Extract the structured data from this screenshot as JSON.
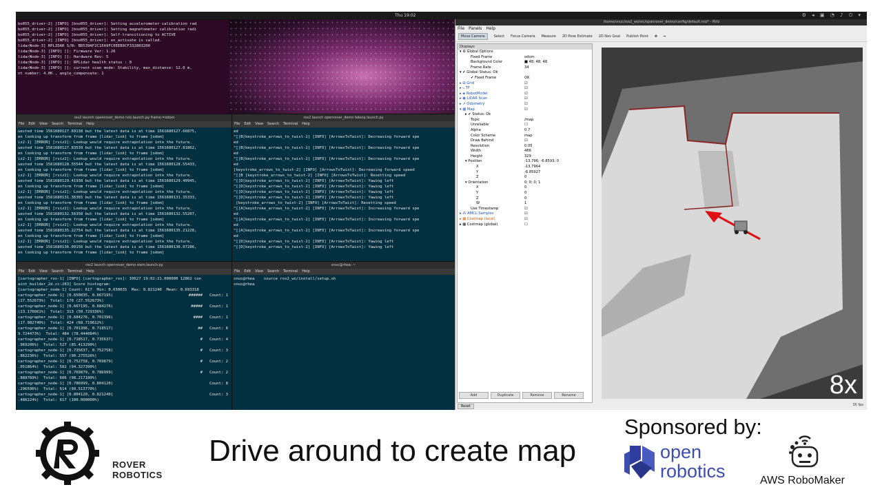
{
  "topbar": {
    "clock": "Thu 19:02",
    "tray": "⚙ ◂ ▣ ◔ ♪ ⏻ ▾"
  },
  "terminals": {
    "drive": {
      "lines": [
        "bo055_driver-2] [INFO] [bno055_driver]: Setting accelerometer calibration rad",
        "",
        "bo055_driver-2] [INFO] [bno055_driver]: Setting magnetometer calibration radi",
        "",
        "bo055_driver-2] [INFO] [bno055_driver]: Self-transitioning to ACTIVE",
        "bo055_driver-2] [INFO] [bno055_driver]: on_activate is called.",
        "lidarNode-3] RPLIDAR S/N: BD539AF2C1EA9FC0EEB9CF332803200",
        "lidarNode-3] [INFO] []: Firmware Ver: 1.26",
        "lidarNode-3] [INFO] []: Hardware Rev: 5",
        "lidarNode-3] [INFO] []: RPLidar health status : 0",
        "lidarNode-3] [INFO] []: current scan mode: Stability, max_distance: 12.0 m,",
        "nt number: 4.0K , angle_compensate: 1"
      ]
    },
    "rviz": {
      "title": "ros2 launch openrover_demo rviz.launch.py frame:=odom",
      "menu": [
        "File",
        "Edit",
        "View",
        "Search",
        "Terminal",
        "Help"
      ],
      "lines": [
        "uested time 1561680127.69138 but the latest data is at time 1561680127.66875,",
        "en looking up transform from frame [lidar_link] to frame [odom]",
        "iz2-1] [ERROR] [rviz2]: Lookup would require extrapolation into the future.",
        "uested time 1561680127.83539 but the latest data is at time 1561680127.81862,",
        "en looking up transform from frame [lidar_link] to frame [odom]",
        "iz2-1] [ERROR] [rviz2]: Lookup would require extrapolation into the future.",
        "uested time 1561680128.55544 but the latest data is at time 1561680128.55433,",
        "en looking up transform from frame [lidar_link] to frame [odom]",
        "iz2-1] [ERROR] [rviz2]: Lookup would require extrapolation into the future.",
        "uested time 1561680129.41938 but the latest data is at time 1561680129.40945,",
        "en looking up transform from frame [lidar_link] to frame [odom]",
        "iz2-1] [ERROR] [rviz2]: Lookup would require extrapolation into the future.",
        "uested time 1561680131.36365 but the latest data is at time 1561680131.35333,",
        "en looking up transform from frame [lidar_link] to frame [odom]",
        "iz2-1] [ERROR] [rviz2]: Lookup would require extrapolation into the future.",
        "uested time 1561680132.56358 but the latest data is at time 1561680132.55207,",
        "en looking up transform from frame [lidar_link] to frame [odom]",
        "iz2-1] [ERROR] [rviz2]: Lookup would require extrapolation into the future.",
        "uested time 1561680135.22754 but the latest data is at time 1561680135.21228,",
        "en looking up transform from frame [lidar_link] to frame [odom]",
        "iz2-1] [ERROR] [rviz2]: Lookup would require extrapolation into the future.",
        "uested time 1561680136.09156 but the latest data is at time 1561680136.07286,",
        "en looking up transform from frame [lidar_link] to frame [odom]"
      ]
    },
    "teleop": {
      "title": "ros2 launch openrover_demo teleop.launch.py",
      "menu": [
        "File",
        "Edit",
        "View",
        "Search",
        "Terminal",
        "Help"
      ],
      "lines": [
        "ed",
        "^[[B[keystroke_arrows_to_twist-2] [INFO] [ArrowsToTwist]: Decreasing forward spe",
        "ed",
        "^[[B[keystroke_arrows_to_twist-2] [INFO] [ArrowsToTwist]: Decreasing forward spe",
        "ed",
        "^[[B[keystroke_arrows_to_twist-2] [INFO] [ArrowsToTwist]: Decreasing forward spe",
        "ed",
        "[keystroke_arrows_to_twist-2] [INFO] [ArrowsToTwist]: Decreasing forward speed",
        "^[[B [keystroke_arrows_to_twist-2] [INFO] [ArrowsToTwist]: Resetting speed",
        "^[[D[keystroke_arrows_to_twist-2] [INFO] [ArrowsToTwist]: Yawing left",
        "^[[D[keystroke_arrows_to_twist-2] [INFO] [ArrowsToTwist]: Yawing left",
        "^[[D[keystroke_arrows_to_twist-2] [INFO] [ArrowsToTwist]: Yawing left",
        "^[[D[keystroke_arrows_to_twist-2] [INFO] [ArrowsToTwist]: Yawing left",
        " [keystroke_arrows_to_twist-2] [INFO] [ArrowsToTwist]: Resetting speed",
        "^[[A[keystroke_arrows_to_twist-2] [INFO] [ArrowsToTwist]: Increasing forward spe",
        "ed",
        "^[[A[keystroke_arrows_to_twist-2] [INFO] [ArrowsToTwist]: Increasing forward spe",
        "ed",
        "^[[A[keystroke_arrows_to_twist-2] [INFO] [ArrowsToTwist]: Increasing forward spe",
        "ed",
        "^[[D[keystroke_arrows_to_twist-2] [INFO] [ArrowsToTwist]: Yawing left",
        "^[[D[keystroke_arrows_to_twist-2] [INFO] [ArrowsToTwist]: Yawing left"
      ]
    },
    "slam": {
      "title": "ros2 launch openrover_demo slam.launch.py",
      "menu": [
        "File",
        "Edit",
        "View",
        "Search",
        "Terminal",
        "Help"
      ],
      "lines": [
        {
          "l": "[cartographer_ros-1] [INFO] [cartographer_ros]: I0627 19:02:21.000000 12862 con",
          "r": ""
        },
        {
          "l": "aint_builder_2d.cc:283] Score histogram:",
          "r": ""
        },
        {
          "l": "[cartographer_node-1] Count: 617  Min: 0.650035  Max: 0.821240  Mean: 0.693318",
          "r": ""
        },
        {
          "l": "cartographer_node-1] [0.650035, 0.667195)",
          "r": "######   Count: 1"
        },
        {
          "l": "(27.552673%)  Total: 170 (27.552673%)",
          "r": ""
        },
        {
          "l": "cartographer_node-1] [0.667195, 0.684276)",
          "r": "#####   Count: 1"
        },
        {
          "l": "(23.176661%)  Total: 313 (50.729336%)",
          "r": ""
        },
        {
          "l": "cartographer_node-1] [0.684276, 0.701396)",
          "r": "####   Count: 1"
        },
        {
          "l": "(17.982740%)  Total: 424 (68.719612%)",
          "r": ""
        },
        {
          "l": "cartographer_node-1] [0.701396, 0.718517)",
          "r": "##   Count: 6"
        },
        {
          "l": "9.724473%)  Total: 484 (78.444084%)",
          "r": ""
        },
        {
          "l": "cartographer_node-1] [0.718517, 0.735637)",
          "r": "#   Count: 4"
        },
        {
          "l": ".969206%)  Total: 527 (85.413290%)",
          "r": ""
        },
        {
          "l": "cartographer_node-1] [0.735637, 0.752758)",
          "r": "#   Count: 3"
        },
        {
          "l": ".862236%)  Total: 557 (90.275526%)",
          "r": ""
        },
        {
          "l": "cartographer_node-1] [0.752758, 0.769879)",
          "r": "#   Count: 2"
        },
        {
          "l": ".051864%)  Total: 582 (94.327390%)",
          "r": ""
        },
        {
          "l": "cartographer_node-1] [0.769879, 0.786999)",
          "r": "#   Count: 2"
        },
        {
          "l": ".889789%)  Total: 606 (98.217180%)",
          "r": ""
        },
        {
          "l": "cartographer_node-1] [0.786999, 0.804120)",
          "r": "Count: 8"
        },
        {
          "l": ".296596%)  Total: 614 (99.513770%)",
          "r": ""
        },
        {
          "l": "cartographer_node-1] [0.804120, 0.821240]",
          "r": "Count: 3"
        },
        {
          "l": ".486224%)  Total: 617 (100.000000%)",
          "r": ""
        }
      ]
    },
    "shell": {
      "title": "snuc@rhea: ~",
      "menu": [
        "File",
        "Edit",
        "View",
        "Search",
        "Terminal",
        "Help"
      ],
      "lines": [
        "snuc@rhea    source ros2_ws/install/setup.sh",
        "snuc@rhea    "
      ]
    }
  },
  "rviz": {
    "title": "/home/snuc/ros2_ws/src/openrover_demo/config/default.rviz* - RViz",
    "menu": [
      "File",
      "Panels",
      "Help"
    ],
    "tools": [
      "Move Camera",
      "Select",
      "Focus Camera",
      "Measure",
      "2D Pose Estimate",
      "2D Nav Goal",
      "Publish Point",
      "✥",
      "━"
    ],
    "panel_title": "Displays",
    "rows": [
      {
        "k": "▾ ⚙ Global Options",
        "v": "",
        "i": 0,
        "c": ""
      },
      {
        "k": "Fixed Frame",
        "v": "odom",
        "i": 2,
        "c": ""
      },
      {
        "k": "Background Color",
        "v": "■ 48; 48; 48",
        "i": 2,
        "c": ""
      },
      {
        "k": "Frame Rate",
        "v": "34",
        "i": 2,
        "c": ""
      },
      {
        "k": "▾ ✔ Global Status: Ok",
        "v": "",
        "i": 0,
        "c": ""
      },
      {
        "k": "✔ Fixed Frame",
        "v": "OK",
        "i": 2,
        "c": ""
      },
      {
        "k": "▸ ⊞ Grid",
        "v": "☑",
        "i": 0,
        "c": "blue"
      },
      {
        "k": "▸ ⤷ TF",
        "v": "☑",
        "i": 0,
        "c": "blue"
      },
      {
        "k": "▸ ◈ RobotModel",
        "v": "☑",
        "i": 0,
        "c": "blue"
      },
      {
        "k": "▸ ◉ LIDAR Scan",
        "v": "☑",
        "i": 0,
        "c": "blue"
      },
      {
        "k": "▸ ↗ Odometry",
        "v": "☑",
        "i": 0,
        "c": "blue"
      },
      {
        "k": "▾ ▦ Map",
        "v": "☑",
        "i": 0,
        "c": "blue"
      },
      {
        "k": "▸ ✔ Status: Ok",
        "v": "",
        "i": 1,
        "c": ""
      },
      {
        "k": "Topic",
        "v": "/map",
        "i": 2,
        "c": ""
      },
      {
        "k": "Unreliable",
        "v": "☐",
        "i": 2,
        "c": ""
      },
      {
        "k": "Alpha",
        "v": "0.7",
        "i": 2,
        "c": ""
      },
      {
        "k": "Color Scheme",
        "v": "map",
        "i": 2,
        "c": ""
      },
      {
        "k": "Draw Behind",
        "v": "☑",
        "i": 2,
        "c": ""
      },
      {
        "k": "Resolution",
        "v": "0.05",
        "i": 2,
        "c": ""
      },
      {
        "k": "Width",
        "v": "486",
        "i": 2,
        "c": ""
      },
      {
        "k": "Height",
        "v": "329",
        "i": 2,
        "c": ""
      },
      {
        "k": "▾ Position",
        "v": "-13.796; -6.8593; 0",
        "i": 1,
        "c": ""
      },
      {
        "k": "X",
        "v": "-13.7964",
        "i": 3,
        "c": ""
      },
      {
        "k": "Y",
        "v": "-6.85927",
        "i": 3,
        "c": ""
      },
      {
        "k": "Z",
        "v": "0",
        "i": 3,
        "c": ""
      },
      {
        "k": "▾ Orientation",
        "v": "0; 0; 0; 1",
        "i": 1,
        "c": ""
      },
      {
        "k": "X",
        "v": "0",
        "i": 3,
        "c": ""
      },
      {
        "k": "Y",
        "v": "0",
        "i": 3,
        "c": ""
      },
      {
        "k": "Z",
        "v": "0",
        "i": 3,
        "c": ""
      },
      {
        "k": "W",
        "v": "1",
        "i": 3,
        "c": ""
      },
      {
        "k": "Use Timestamp",
        "v": "☑",
        "i": 2,
        "c": ""
      },
      {
        "k": "▸ ⁂ AMCL Samples",
        "v": "☑",
        "i": 0,
        "c": "blue"
      },
      {
        "k": "▸ ▦ Costmap (local)",
        "v": "☑",
        "i": 0,
        "c": "orange"
      },
      {
        "k": "▸ ▦ Costmap (global)",
        "v": "☐",
        "i": 0,
        "c": ""
      }
    ],
    "buttons": [
      "Add",
      "Duplicate",
      "Remove",
      "Rename"
    ],
    "reset": "Reset",
    "fps": "35 fps",
    "speed_overlay": "8x"
  },
  "banner": {
    "rover_line1": "ROVER",
    "rover_line2": "ROBOTICS",
    "headline": "Drive around to create map",
    "sponsored": "Sponsored by:",
    "open_word": "open",
    "robotics_word": "robotics",
    "robomaker": "AWS RoboMaker"
  }
}
